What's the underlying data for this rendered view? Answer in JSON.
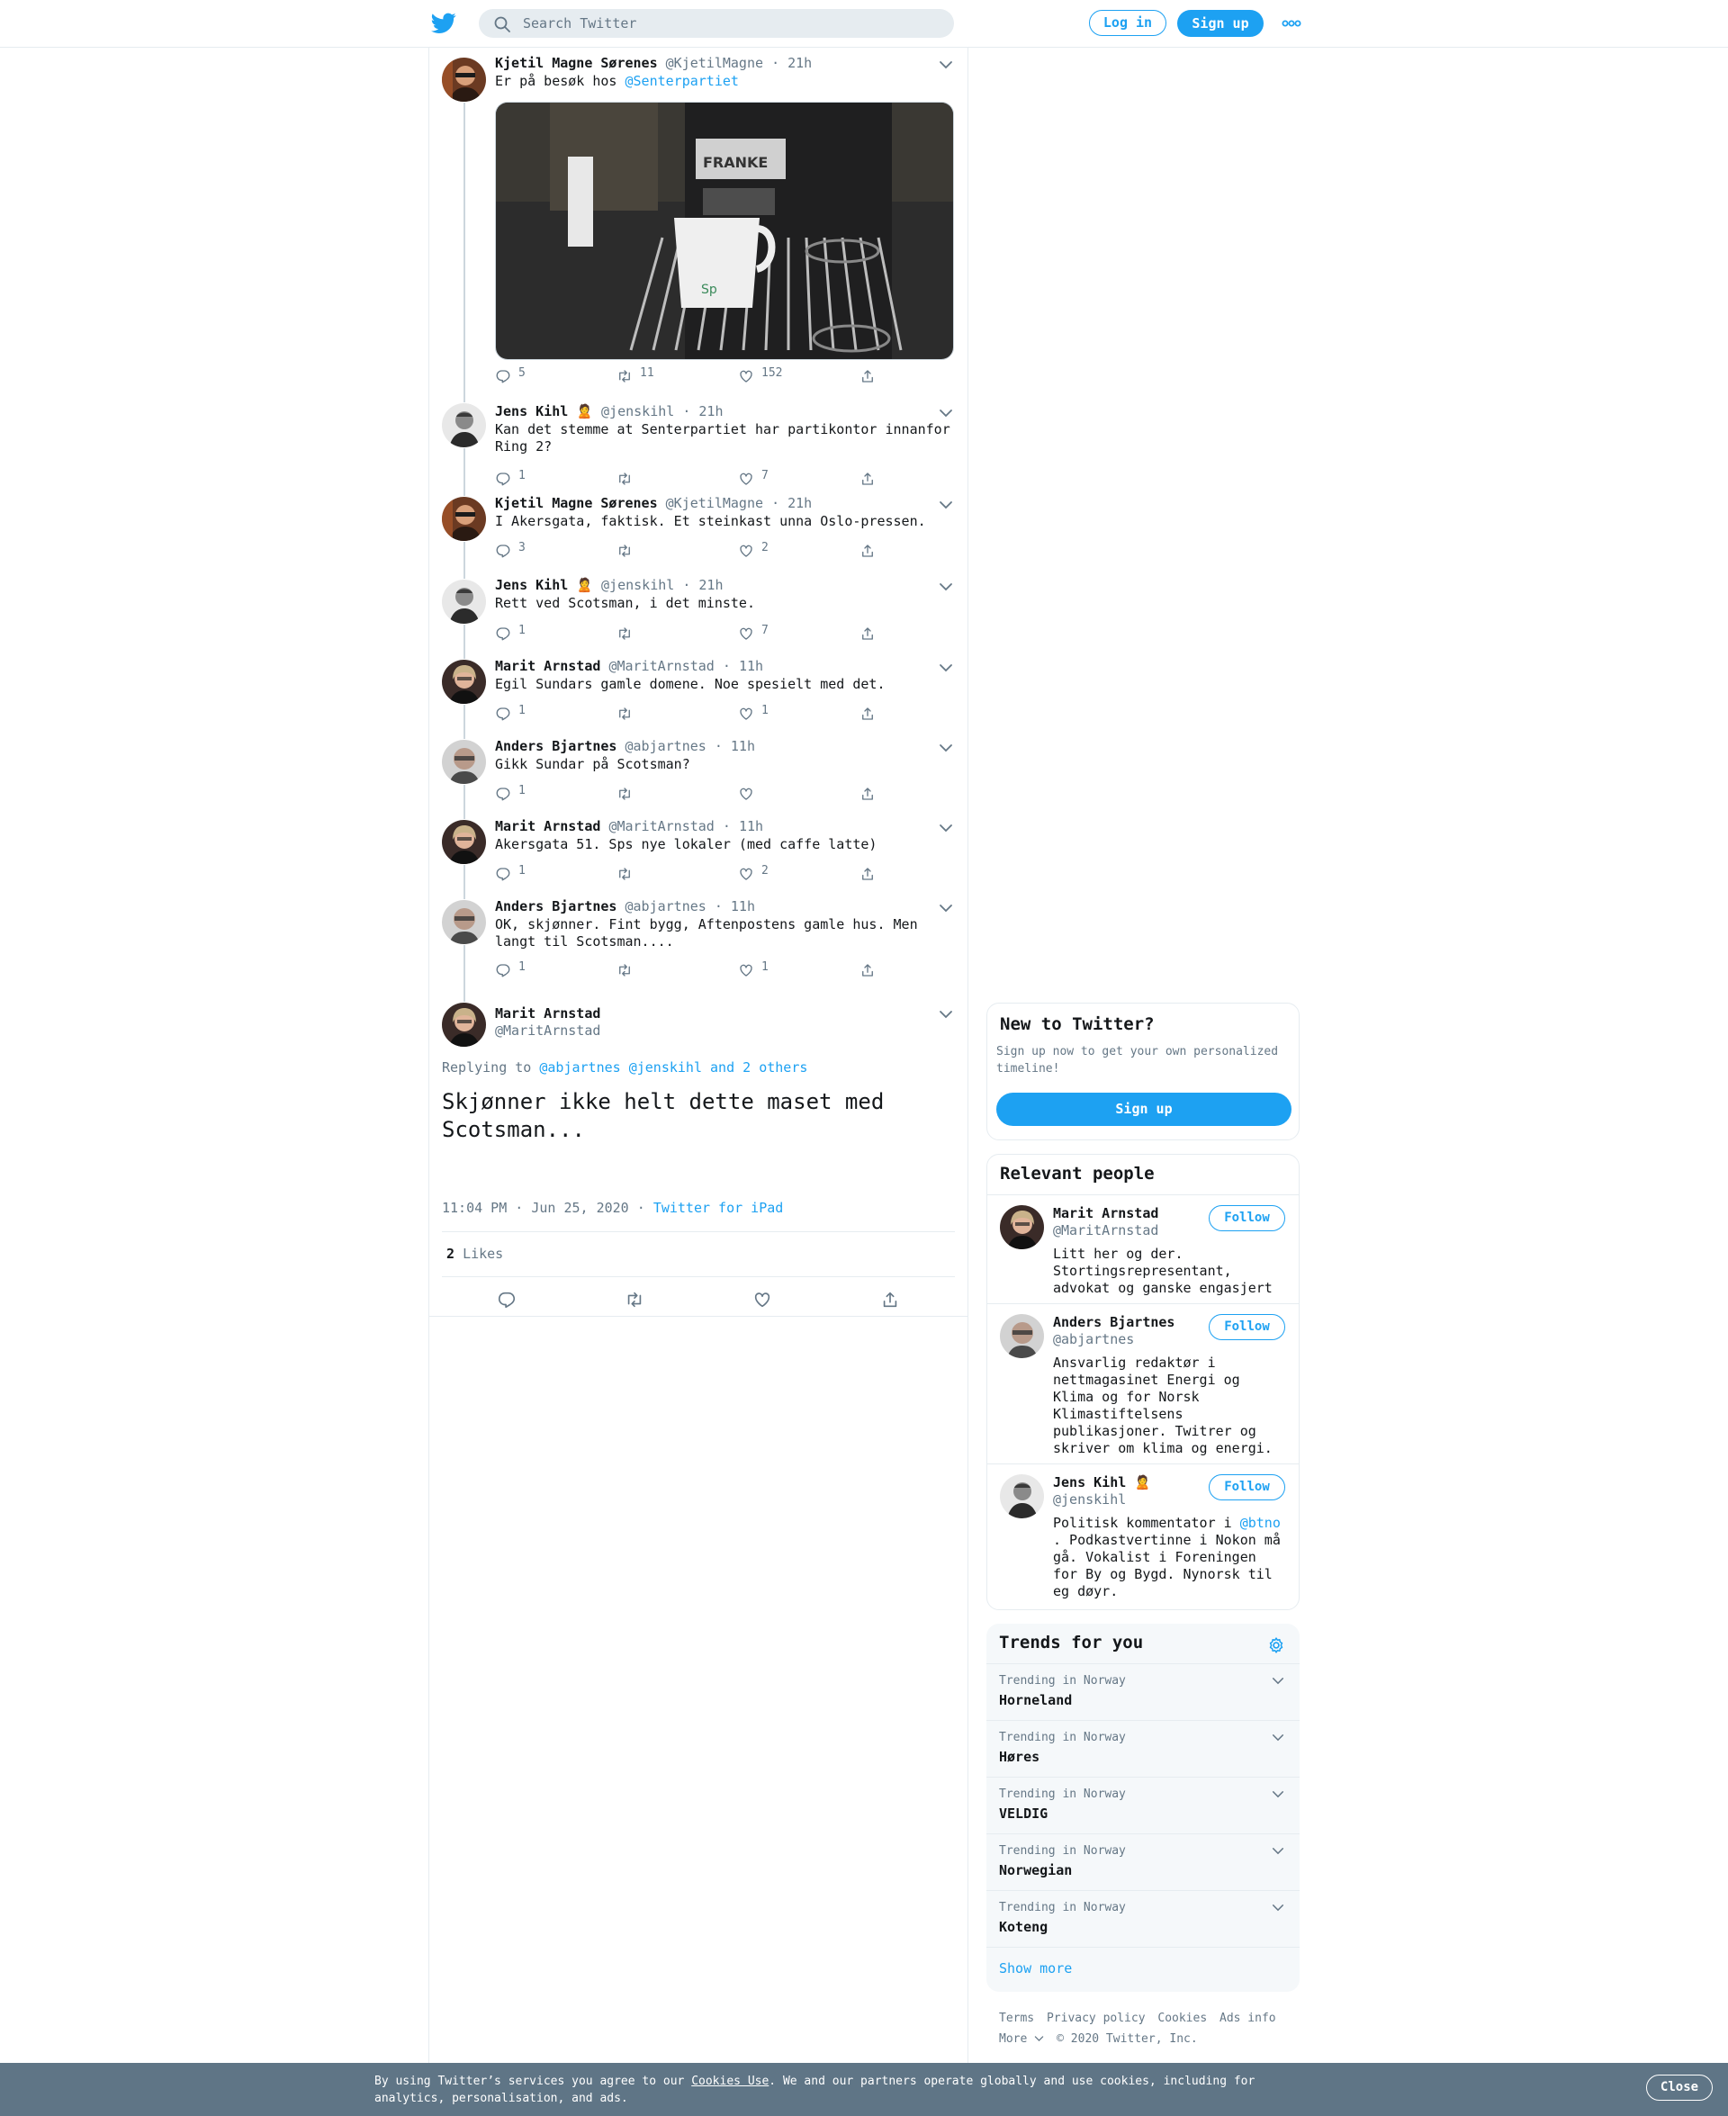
{
  "header": {
    "search_placeholder": "Search Twitter",
    "login_label": "Log in",
    "signup_label": "Sign up"
  },
  "thread": [
    {
      "name": "Kjetil Magne Sørenes",
      "emoji": "",
      "handle": "@KjetilMagne",
      "time": "21h",
      "text_prefix": "Er på besøk hos ",
      "mention": "@Senterpartiet",
      "replies": "5",
      "retweets": "11",
      "likes": "152"
    },
    {
      "name": "Jens Kihl",
      "emoji": "🙎",
      "handle": "@jenskihl",
      "time": "21h",
      "text": "Kan det stemme at Senterpartiet har partikontor innanfor Ring 2?",
      "replies": "1",
      "retweets": "",
      "likes": "7"
    },
    {
      "name": "Kjetil Magne Sørenes",
      "emoji": "",
      "handle": "@KjetilMagne",
      "time": "21h",
      "text": "I Akersgata, faktisk. Et steinkast unna Oslo-pressen.",
      "replies": "3",
      "retweets": "",
      "likes": "2"
    },
    {
      "name": "Jens Kihl",
      "emoji": "🙎",
      "handle": "@jenskihl",
      "time": "21h",
      "text": "Rett ved Scotsman, i det minste.",
      "replies": "1",
      "retweets": "",
      "likes": "7"
    },
    {
      "name": "Marit Arnstad",
      "emoji": "",
      "handle": "@MaritArnstad",
      "time": "11h",
      "text": "Egil Sundars gamle domene.  Noe spesielt med det.",
      "replies": "1",
      "retweets": "",
      "likes": "1"
    },
    {
      "name": "Anders Bjartnes",
      "emoji": "",
      "handle": "@abjartnes",
      "time": "11h",
      "text": "Gikk Sundar på Scotsman?",
      "replies": "1",
      "retweets": "",
      "likes": ""
    },
    {
      "name": "Marit Arnstad",
      "emoji": "",
      "handle": "@MaritArnstad",
      "time": "11h",
      "text": "Akersgata 51. Sps nye lokaler (med caffe latte)",
      "replies": "1",
      "retweets": "",
      "likes": "2"
    },
    {
      "name": "Anders Bjartnes",
      "emoji": "",
      "handle": "@abjartnes",
      "time": "11h",
      "text": "OK, skjønner. Fint bygg, Aftenpostens gamle hus. Men langt til Scotsman....",
      "replies": "1",
      "retweets": "",
      "likes": "1"
    }
  ],
  "photo": {
    "brand_text": "FRANKE",
    "cup_text": "Sp"
  },
  "main_tweet": {
    "name": "Marit Arnstad",
    "handle": "@MaritArnstad",
    "replying_label": "Replying to",
    "replying_to": "@abjartnes @jenskihl and 2 others",
    "text_line1": "Skjønner ikke helt dette maset med",
    "text_line2": "Scotsman...",
    "timestamp": "11:04 PM · Jun 25, 2020",
    "source": "Twitter for iPad",
    "likes_count": "2",
    "likes_label": "Likes"
  },
  "new_to_twitter": {
    "title": "New to Twitter?",
    "line1": "Sign up now to get your own personalized",
    "line2": "timeline!",
    "button": "Sign up"
  },
  "relevant_people": {
    "title": "Relevant people",
    "follow_label": "Follow",
    "people": [
      {
        "name": "Marit Arnstad",
        "emoji": "",
        "handle": "@MaritArnstad",
        "bio_lines": [
          "Litt her og der.",
          "Stortingsrepresentant,",
          "advokat og ganske engasjert"
        ]
      },
      {
        "name": "Anders Bjartnes",
        "emoji": "",
        "handle": "@abjartnes",
        "bio_lines": [
          "Ansvarlig redaktør i",
          "nettmagasinet Energi og",
          "Klima og for Norsk",
          "Klimastiftelsens",
          "publikasjoner. Twitrer og",
          "skriver om klima og energi."
        ]
      },
      {
        "name": "Jens Kihl",
        "emoji": "🙎",
        "handle": "@jenskihl",
        "bio_prefix": "Politisk kommentator i ",
        "bio_mention": "@btno",
        "bio_lines": [
          ". Podkastvertinne i Nokon må",
          "gå. Vokalist i Foreningen",
          "for By og Bygd. Nynorsk til",
          "eg døyr."
        ]
      }
    ]
  },
  "trends": {
    "title": "Trends for you",
    "items": [
      {
        "meta": "Trending in Norway",
        "name": "Horneland"
      },
      {
        "meta": "Trending in Norway",
        "name": "Høres"
      },
      {
        "meta": "Trending in Norway",
        "name": "VELDIG"
      },
      {
        "meta": "Trending in Norway",
        "name": "Norwegian"
      },
      {
        "meta": "Trending in Norway",
        "name": "Koteng"
      }
    ],
    "show_more": "Show more"
  },
  "footer": {
    "links": [
      "Terms",
      "Privacy policy",
      "Cookies",
      "Ads info"
    ],
    "more": "More",
    "copyright": "© 2020 Twitter, Inc."
  },
  "cookie": {
    "text_before": "By using Twitter’s services you agree to our ",
    "link": "Cookies Use",
    "text_after": ". We and our partners operate globally and use cookies, including for",
    "line2": "analytics, personalisation, and ads.",
    "close": "Close"
  },
  "colors": {
    "accent": "#1da1f2",
    "muted": "#657786",
    "border": "#e6ecf0",
    "cookie_bar": "#5f7586"
  }
}
